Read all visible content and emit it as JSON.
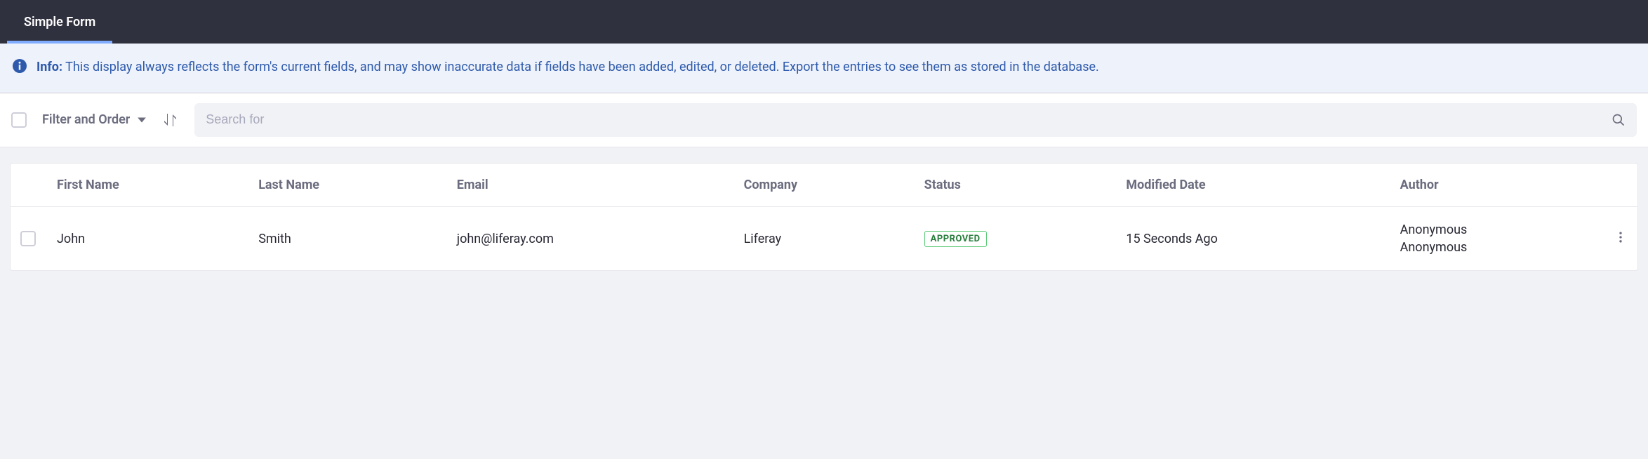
{
  "header": {
    "tabs": [
      {
        "label": "Simple Form",
        "active": true
      }
    ]
  },
  "info": {
    "prefix": "Info:",
    "message": "This display always reflects the form's current fields, and may show inaccurate data if fields have been added, edited, or deleted. Export the entries to see them as stored in the database."
  },
  "toolbar": {
    "filter_order_label": "Filter and Order",
    "search_placeholder": "Search for"
  },
  "table": {
    "columns": [
      "First Name",
      "Last Name",
      "Email",
      "Company",
      "Status",
      "Modified Date",
      "Author"
    ],
    "rows": [
      {
        "first_name": "John",
        "last_name": "Smith",
        "email": "john@liferay.com",
        "company": "Liferay",
        "status": "APPROVED",
        "modified_date": "15 Seconds Ago",
        "author_line1": "Anonymous",
        "author_line2": "Anonymous"
      }
    ]
  },
  "colors": {
    "accent": "#80acff",
    "info": "#2e5aac",
    "status_border": "#5aca75",
    "status_text": "#287d3c"
  }
}
